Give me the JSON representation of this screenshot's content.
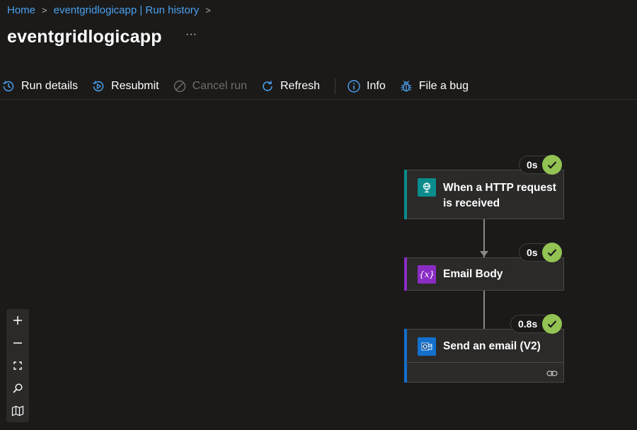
{
  "breadcrumb": {
    "home": "Home",
    "app": "eventgridlogicapp | Run history",
    "separator": ">"
  },
  "page": {
    "title": "eventgridlogicapp",
    "more": "···"
  },
  "toolbar": {
    "run_details": "Run details",
    "resubmit": "Resubmit",
    "cancel_run": "Cancel run",
    "refresh": "Refresh",
    "info": "Info",
    "file_bug": "File a bug"
  },
  "nodes": [
    {
      "label": "When a HTTP request is received",
      "duration": "0s",
      "status": "succeeded",
      "icon": "http-request-icon",
      "accent": "#0b8c8c"
    },
    {
      "label": "Email Body",
      "duration": "0s",
      "status": "succeeded",
      "icon": "variable-icon",
      "accent": "#8a2cc4"
    },
    {
      "label": "Send an email (V2)",
      "duration": "0.8s",
      "status": "succeeded",
      "icon": "outlook-icon",
      "accent": "#1370cd"
    }
  ],
  "colors": {
    "link": "#4aa0f0",
    "success": "#92c353",
    "background": "#1b1a19",
    "card": "#2b2a29"
  },
  "zoom_controls": [
    "zoom-in-icon",
    "zoom-out-icon",
    "fit-view-icon",
    "search-icon",
    "minimap-icon"
  ]
}
